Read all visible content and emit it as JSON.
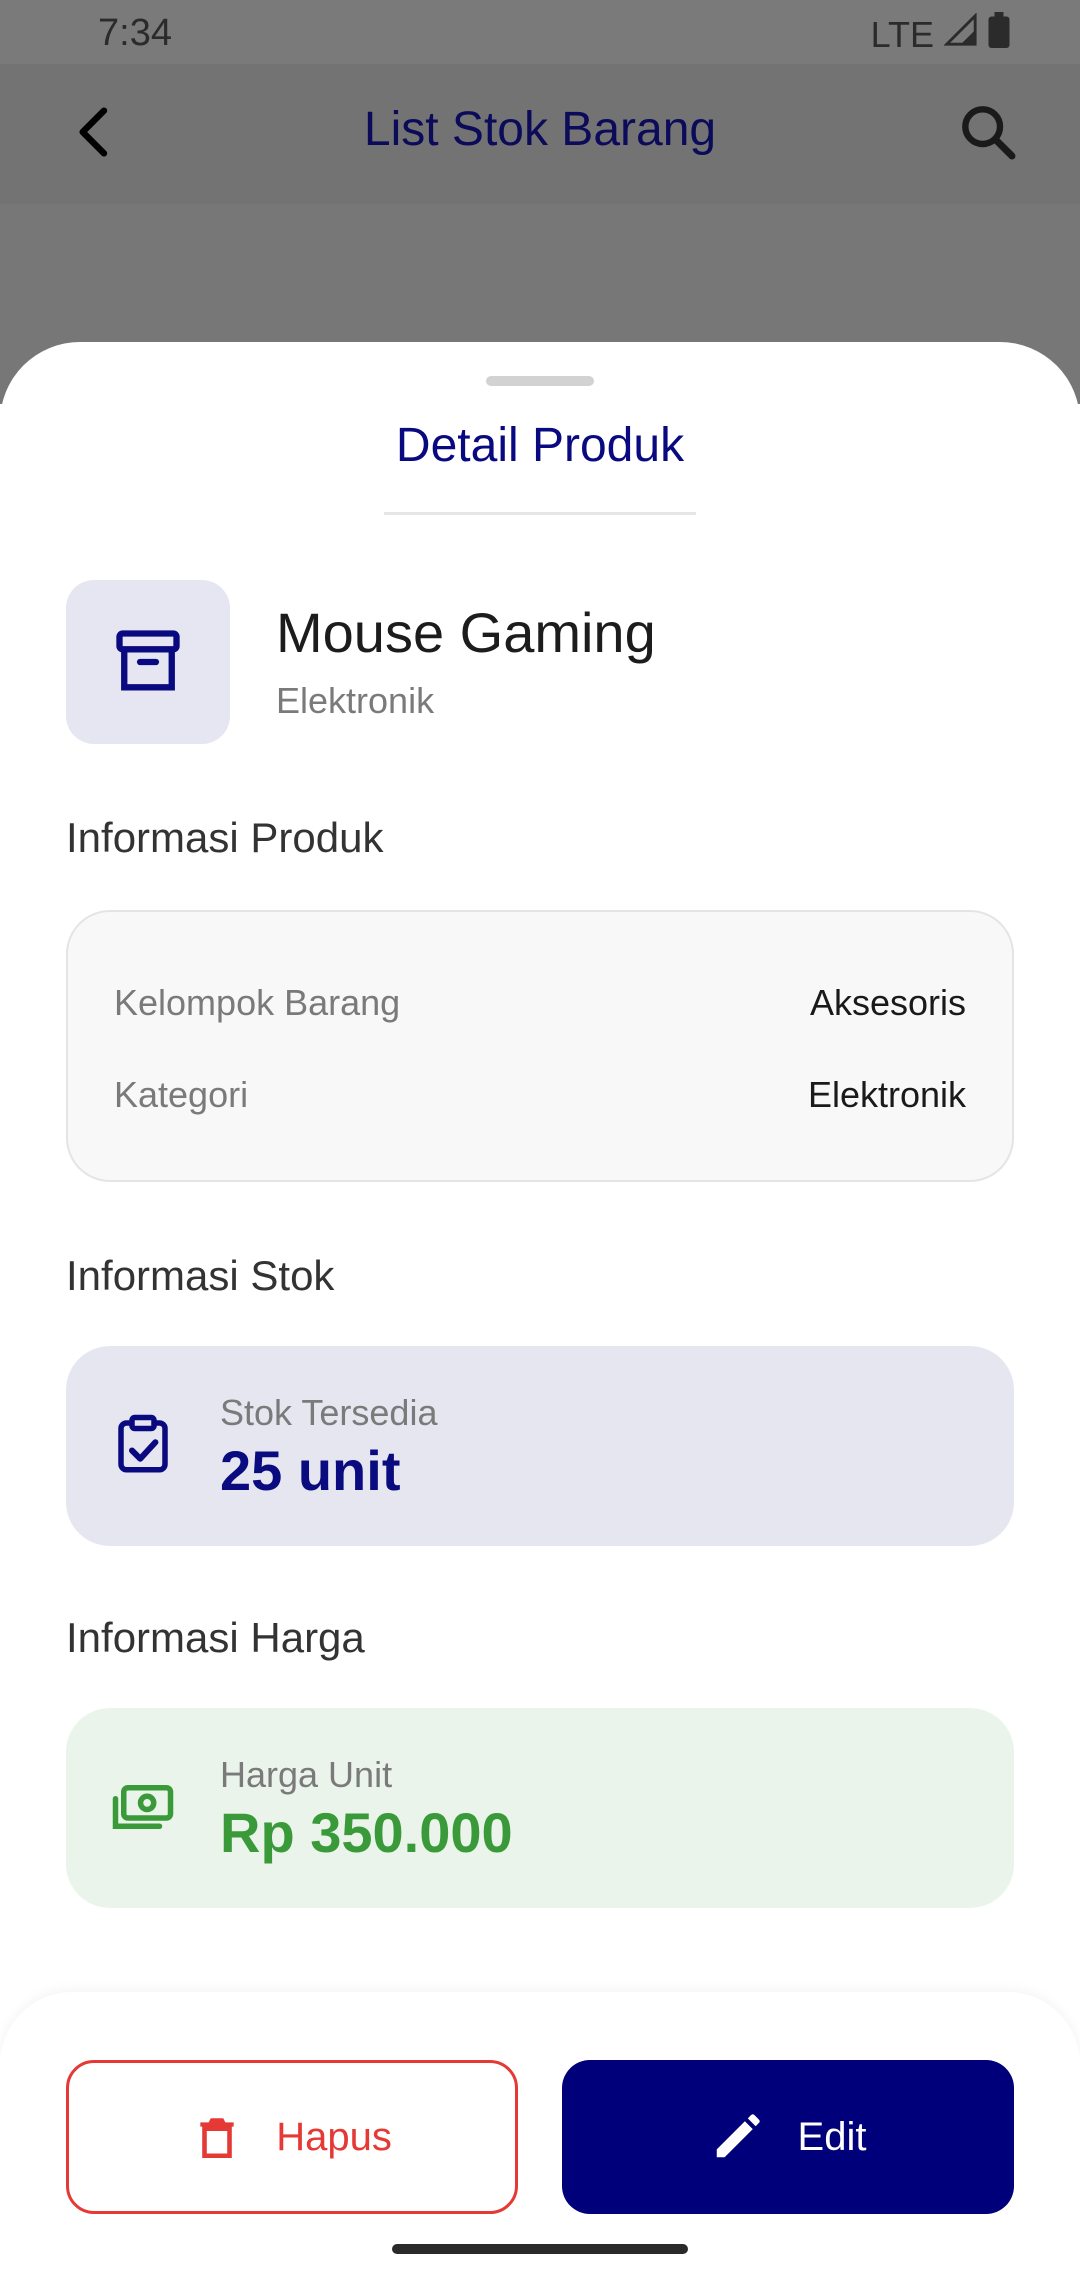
{
  "status_bar": {
    "time": "7:34",
    "network": "LTE"
  },
  "appbar": {
    "title": "List Stok Barang"
  },
  "sheet": {
    "title": "Detail Produk",
    "product": {
      "name": "Mouse Gaming",
      "category": "Elektronik"
    },
    "product_info": {
      "section_label": "Informasi Produk",
      "rows": [
        {
          "key": "Kelompok Barang",
          "value": "Aksesoris"
        },
        {
          "key": "Kategori",
          "value": "Elektronik"
        }
      ]
    },
    "stock_info": {
      "section_label": "Informasi Stok",
      "label": "Stok Tersedia",
      "value": "25 unit"
    },
    "price_info": {
      "section_label": "Informasi Harga",
      "label": "Harga Unit",
      "value": "Rp 350.000"
    }
  },
  "actions": {
    "delete_label": "Hapus",
    "edit_label": "Edit"
  },
  "icons": {
    "back": "arrow-back-icon",
    "search": "search-icon",
    "product": "archive-box-icon",
    "stock": "clipboard-check-icon",
    "price": "money-icon",
    "delete": "trash-icon",
    "edit": "pencil-icon"
  },
  "colors": {
    "primary": "#00007a",
    "danger": "#e53935",
    "success": "#3a9a3a",
    "stock_bg": "#e6e6f1",
    "price_bg": "#eaf4ea"
  }
}
